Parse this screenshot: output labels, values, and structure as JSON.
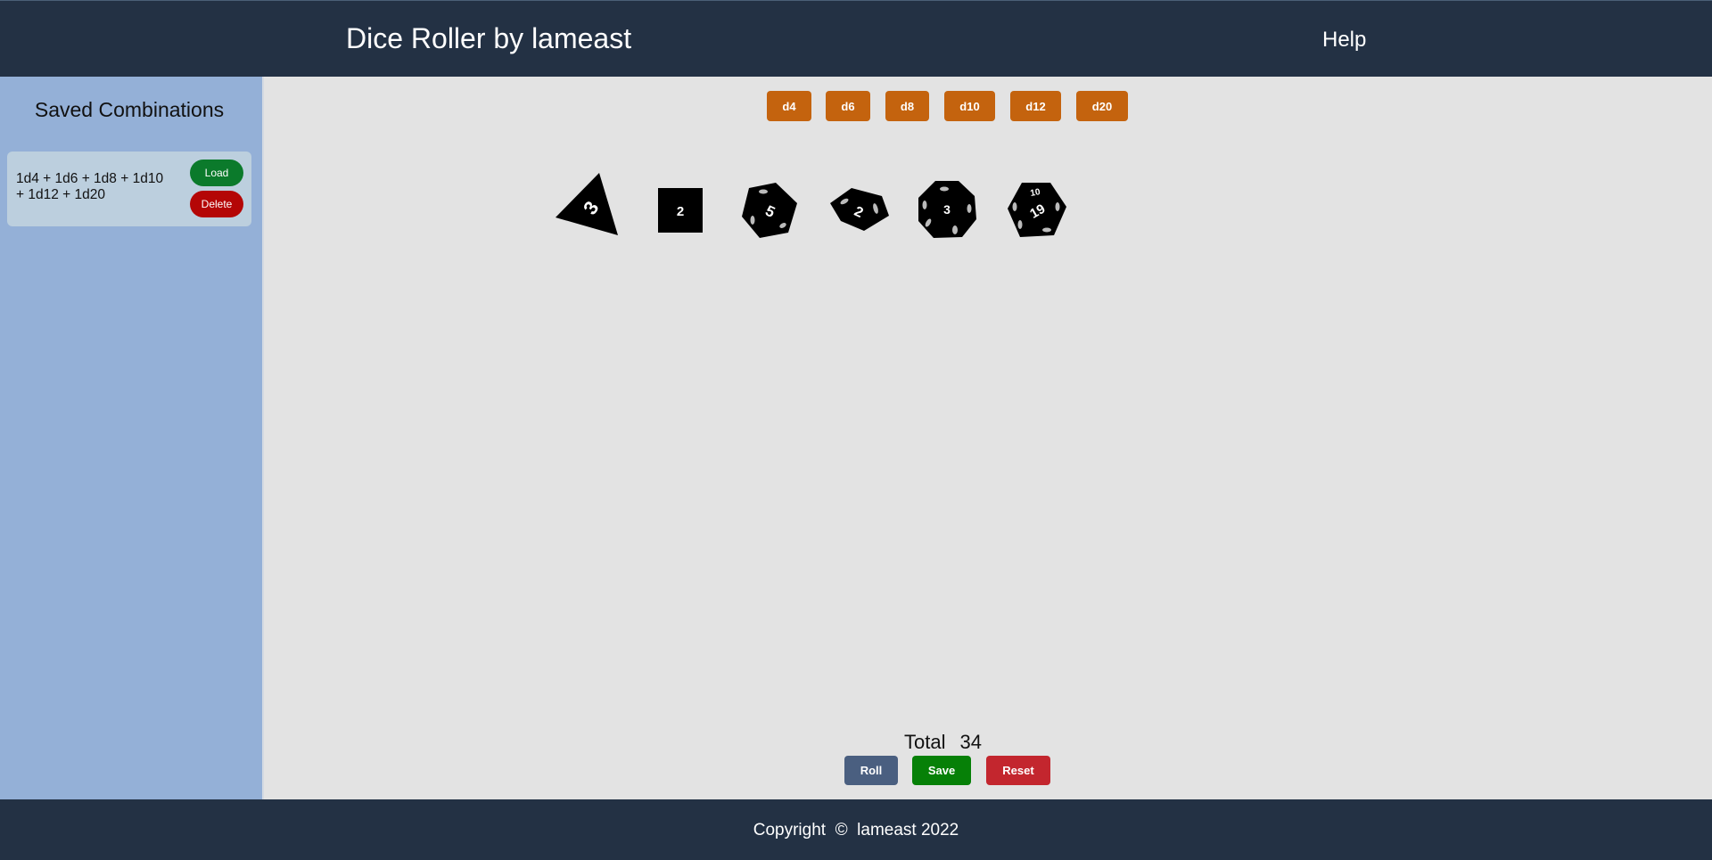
{
  "header": {
    "title": "Dice Roller by lameast",
    "help_label": "Help"
  },
  "sidebar": {
    "title": "Saved Combinations",
    "combinations": [
      {
        "text": "1d4 + 1d6 + 1d8 + 1d10 + 1d12 + 1d20",
        "load_label": "Load",
        "delete_label": "Delete"
      }
    ]
  },
  "dice_buttons": [
    "d4",
    "d6",
    "d8",
    "d10",
    "d12",
    "d20"
  ],
  "rolled_dice": [
    {
      "type": "d4",
      "value": "3",
      "icon": "d4-die-icon"
    },
    {
      "type": "d6",
      "value": "2",
      "icon": "d6-die-icon"
    },
    {
      "type": "d8",
      "value": "5",
      "icon": "d8-die-icon"
    },
    {
      "type": "d10",
      "value": "2",
      "icon": "d10-die-icon"
    },
    {
      "type": "d12",
      "value": "3",
      "icon": "d12-die-icon"
    },
    {
      "type": "d20",
      "value": "19",
      "icon": "d20-die-icon"
    }
  ],
  "total": {
    "label": "Total",
    "value": "34"
  },
  "actions": {
    "roll_label": "Roll",
    "save_label": "Save",
    "reset_label": "Reset"
  },
  "footer": {
    "copyright": "Copyright  ©  lameast 2022"
  },
  "colors": {
    "header_bg": "#233144",
    "sidebar_bg": "#94b0d7",
    "die_button": "#c4630e",
    "load": "#0b7a2b",
    "delete": "#b40606",
    "roll": "#4a5f80",
    "save": "#068007",
    "reset": "#c3262e"
  }
}
